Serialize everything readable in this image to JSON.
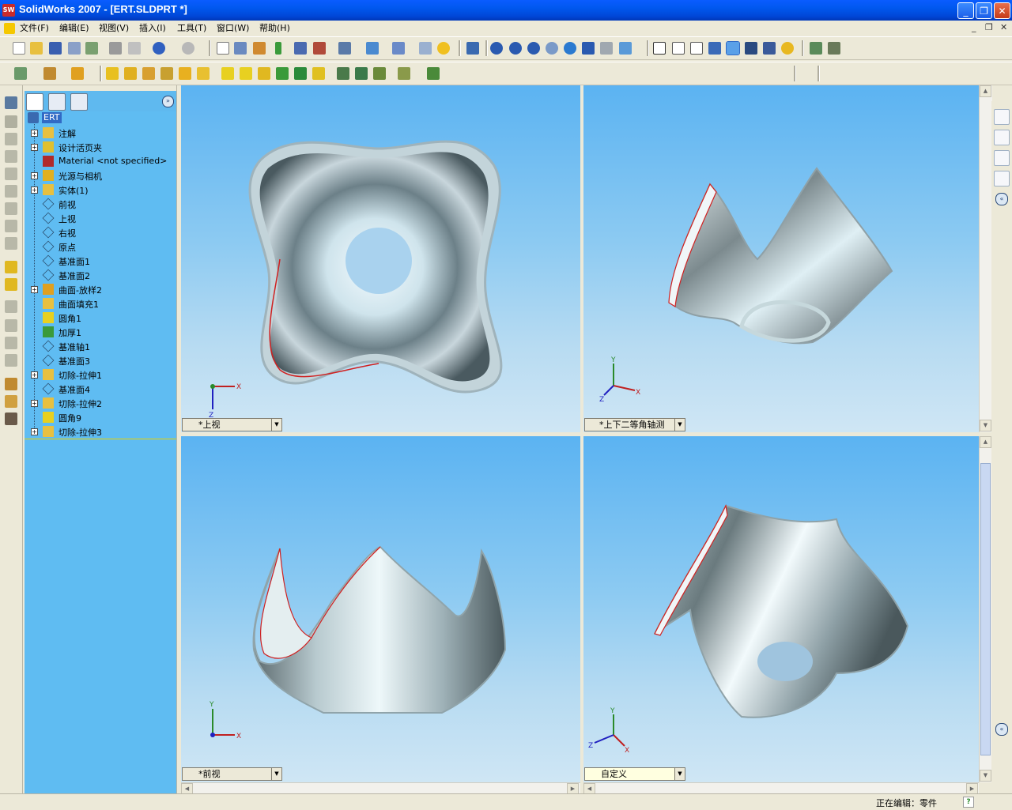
{
  "window": {
    "title": "SolidWorks 2007 - [ERT.SLDPRT *]",
    "app_icon_text": "SW"
  },
  "menu": {
    "items": [
      "文件(F)",
      "编辑(E)",
      "视图(V)",
      "插入(I)",
      "工具(T)",
      "窗口(W)",
      "帮助(H)"
    ]
  },
  "tree": {
    "root": "ERT",
    "items": [
      {
        "label": "注解",
        "expandable": true,
        "icon": "annotation-icon"
      },
      {
        "label": "设计活页夹",
        "expandable": true,
        "icon": "design-binder-icon"
      },
      {
        "label": "Material <not specified>",
        "expandable": false,
        "icon": "material-icon"
      },
      {
        "label": "光源与相机",
        "expandable": true,
        "icon": "lights-cameras-icon"
      },
      {
        "label": "实体(1)",
        "expandable": true,
        "icon": "solid-bodies-icon"
      },
      {
        "label": "前视",
        "expandable": false,
        "icon": "plane-icon"
      },
      {
        "label": "上视",
        "expandable": false,
        "icon": "plane-icon"
      },
      {
        "label": "右视",
        "expandable": false,
        "icon": "plane-icon"
      },
      {
        "label": "原点",
        "expandable": false,
        "icon": "origin-icon"
      },
      {
        "label": "基准面1",
        "expandable": false,
        "icon": "plane-icon"
      },
      {
        "label": "基准面2",
        "expandable": false,
        "icon": "plane-icon"
      },
      {
        "label": "曲面-放样2",
        "expandable": true,
        "icon": "surface-loft-icon"
      },
      {
        "label": "曲面填充1",
        "expandable": false,
        "icon": "surface-fill-icon"
      },
      {
        "label": "圆角1",
        "expandable": false,
        "icon": "fillet-icon"
      },
      {
        "label": "加厚1",
        "expandable": false,
        "icon": "thicken-icon"
      },
      {
        "label": "基准轴1",
        "expandable": false,
        "icon": "axis-icon"
      },
      {
        "label": "基准面3",
        "expandable": false,
        "icon": "plane-icon"
      },
      {
        "label": "切除-拉伸1",
        "expandable": true,
        "icon": "cut-extrude-icon"
      },
      {
        "label": "基准面4",
        "expandable": false,
        "icon": "plane-icon"
      },
      {
        "label": "切除-拉伸2",
        "expandable": true,
        "icon": "cut-extrude-icon"
      },
      {
        "label": "圆角9",
        "expandable": false,
        "icon": "fillet-icon"
      },
      {
        "label": "切除-拉伸3",
        "expandable": true,
        "icon": "cut-extrude-icon"
      }
    ]
  },
  "viewports": {
    "top_left": {
      "view": "*上视",
      "axes": [
        "X",
        "Z"
      ]
    },
    "top_right": {
      "view": "*上下二等角轴测",
      "axes": [
        "Y",
        "X",
        "Z"
      ]
    },
    "bottom_left": {
      "view": "*前视",
      "axes": [
        "Y",
        "X"
      ]
    },
    "bottom_right": {
      "view": "自定义",
      "axes": [
        "Y",
        "Z",
        "X"
      ]
    }
  },
  "status": {
    "text": "正在编辑：零件",
    "help": "?"
  },
  "colors": {
    "title_blue": "#0054e3",
    "viewport_top": "#5bb3f2",
    "viewport_bottom": "#cfe6f4",
    "feature_tree_bg": "#5fbcf2",
    "edge_highlight": "#e02020"
  }
}
